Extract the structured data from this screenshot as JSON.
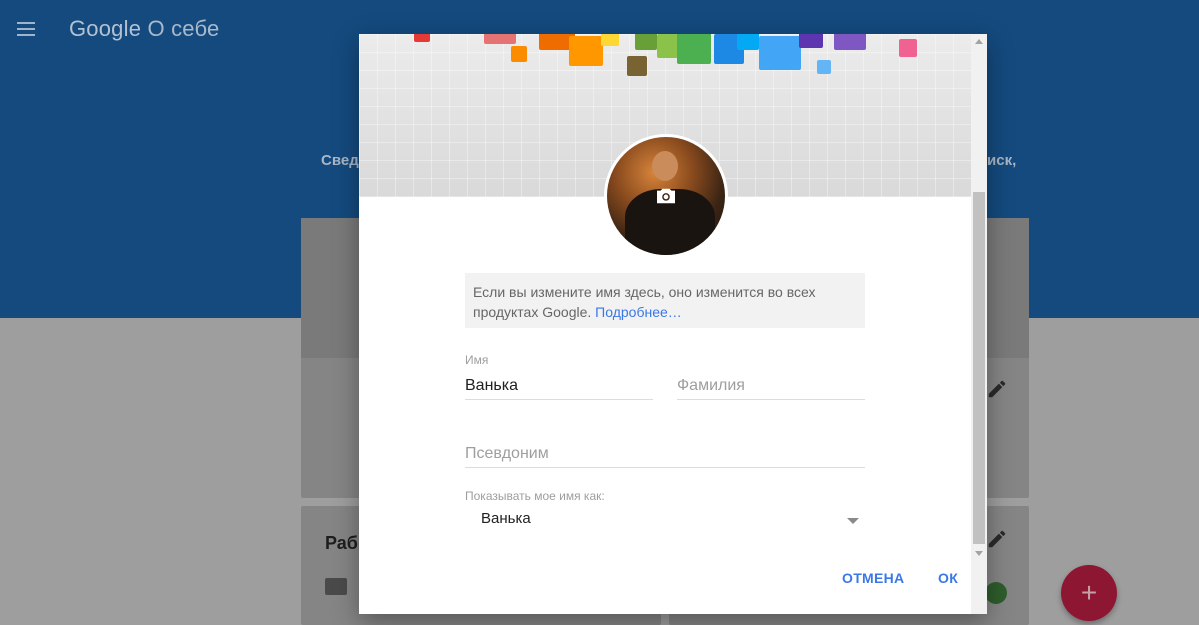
{
  "header": {
    "brand_google": "Google",
    "brand_section": "О себе",
    "menu_icon": "hamburger-menu-icon"
  },
  "background": {
    "hero_text_left": "Свед",
    "hero_text_right": "иск,",
    "card_work_title": "Раб",
    "fab_label": "+"
  },
  "dialog": {
    "notice_text": "Если вы измените имя здесь, оно изменится во всех продуктах Google.",
    "notice_link": "Подробнее…",
    "first_name_label": "Имя",
    "first_name_value": "Ванька",
    "last_name_placeholder": "Фамилия",
    "nickname_placeholder": "Псевдоним",
    "display_as_label": "Показывать мое имя как:",
    "display_as_value": "Ванька",
    "cancel_label": "ОТМЕНА",
    "ok_label": "ОК"
  },
  "colors": {
    "header_bg": "#144a7e",
    "accent": "#3b78e7",
    "fab": "#8d1632"
  }
}
